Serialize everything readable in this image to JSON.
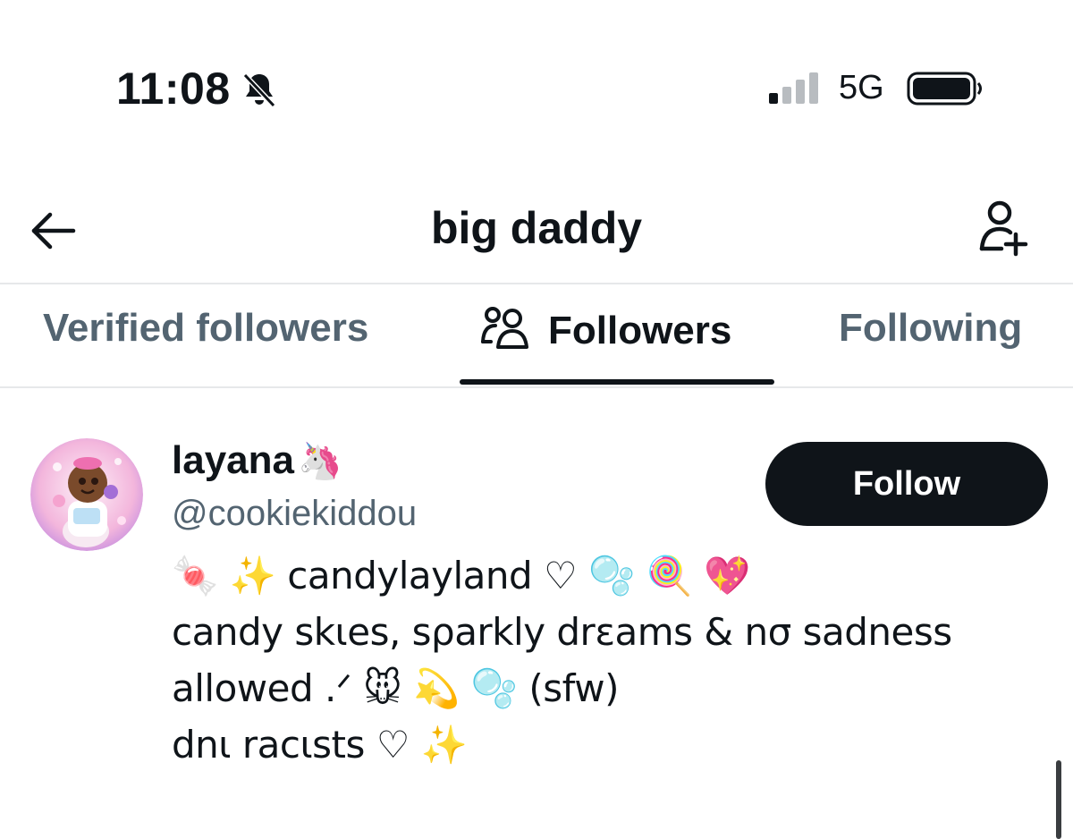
{
  "status_bar": {
    "time": "11:08",
    "bell_icon": "bell-slash-icon",
    "network": "5G",
    "signal_icon": "cellular-signal-icon",
    "battery_icon": "battery-icon"
  },
  "header": {
    "back_icon": "arrow-left-icon",
    "title": "big daddy",
    "add_user_icon": "add-user-icon"
  },
  "tabs": [
    {
      "label": "Verified followers",
      "selected": false
    },
    {
      "label": "Followers",
      "selected": true,
      "icon": "people-icon"
    },
    {
      "label": "Following",
      "selected": false
    }
  ],
  "user": {
    "display_name": "layana",
    "name_emoji": "🦄",
    "handle": "@cookiekiddou",
    "follow_label": "Follow",
    "bio_lines": [
      "🍬 ✨ candylayland ♡ 🫧 🍭 💖",
      "candy skιes, sρarkly drɛams & nσ sadness",
      "allowed .ᐟ 🐭 💫 🫧 (sfw)",
      "dnι racιsts ♡ ✨"
    ]
  },
  "colors": {
    "text_primary": "#0f1419",
    "text_secondary": "#536471",
    "divider": "#e6e8ea",
    "button_bg": "#0f1419",
    "button_text": "#ffffff"
  }
}
